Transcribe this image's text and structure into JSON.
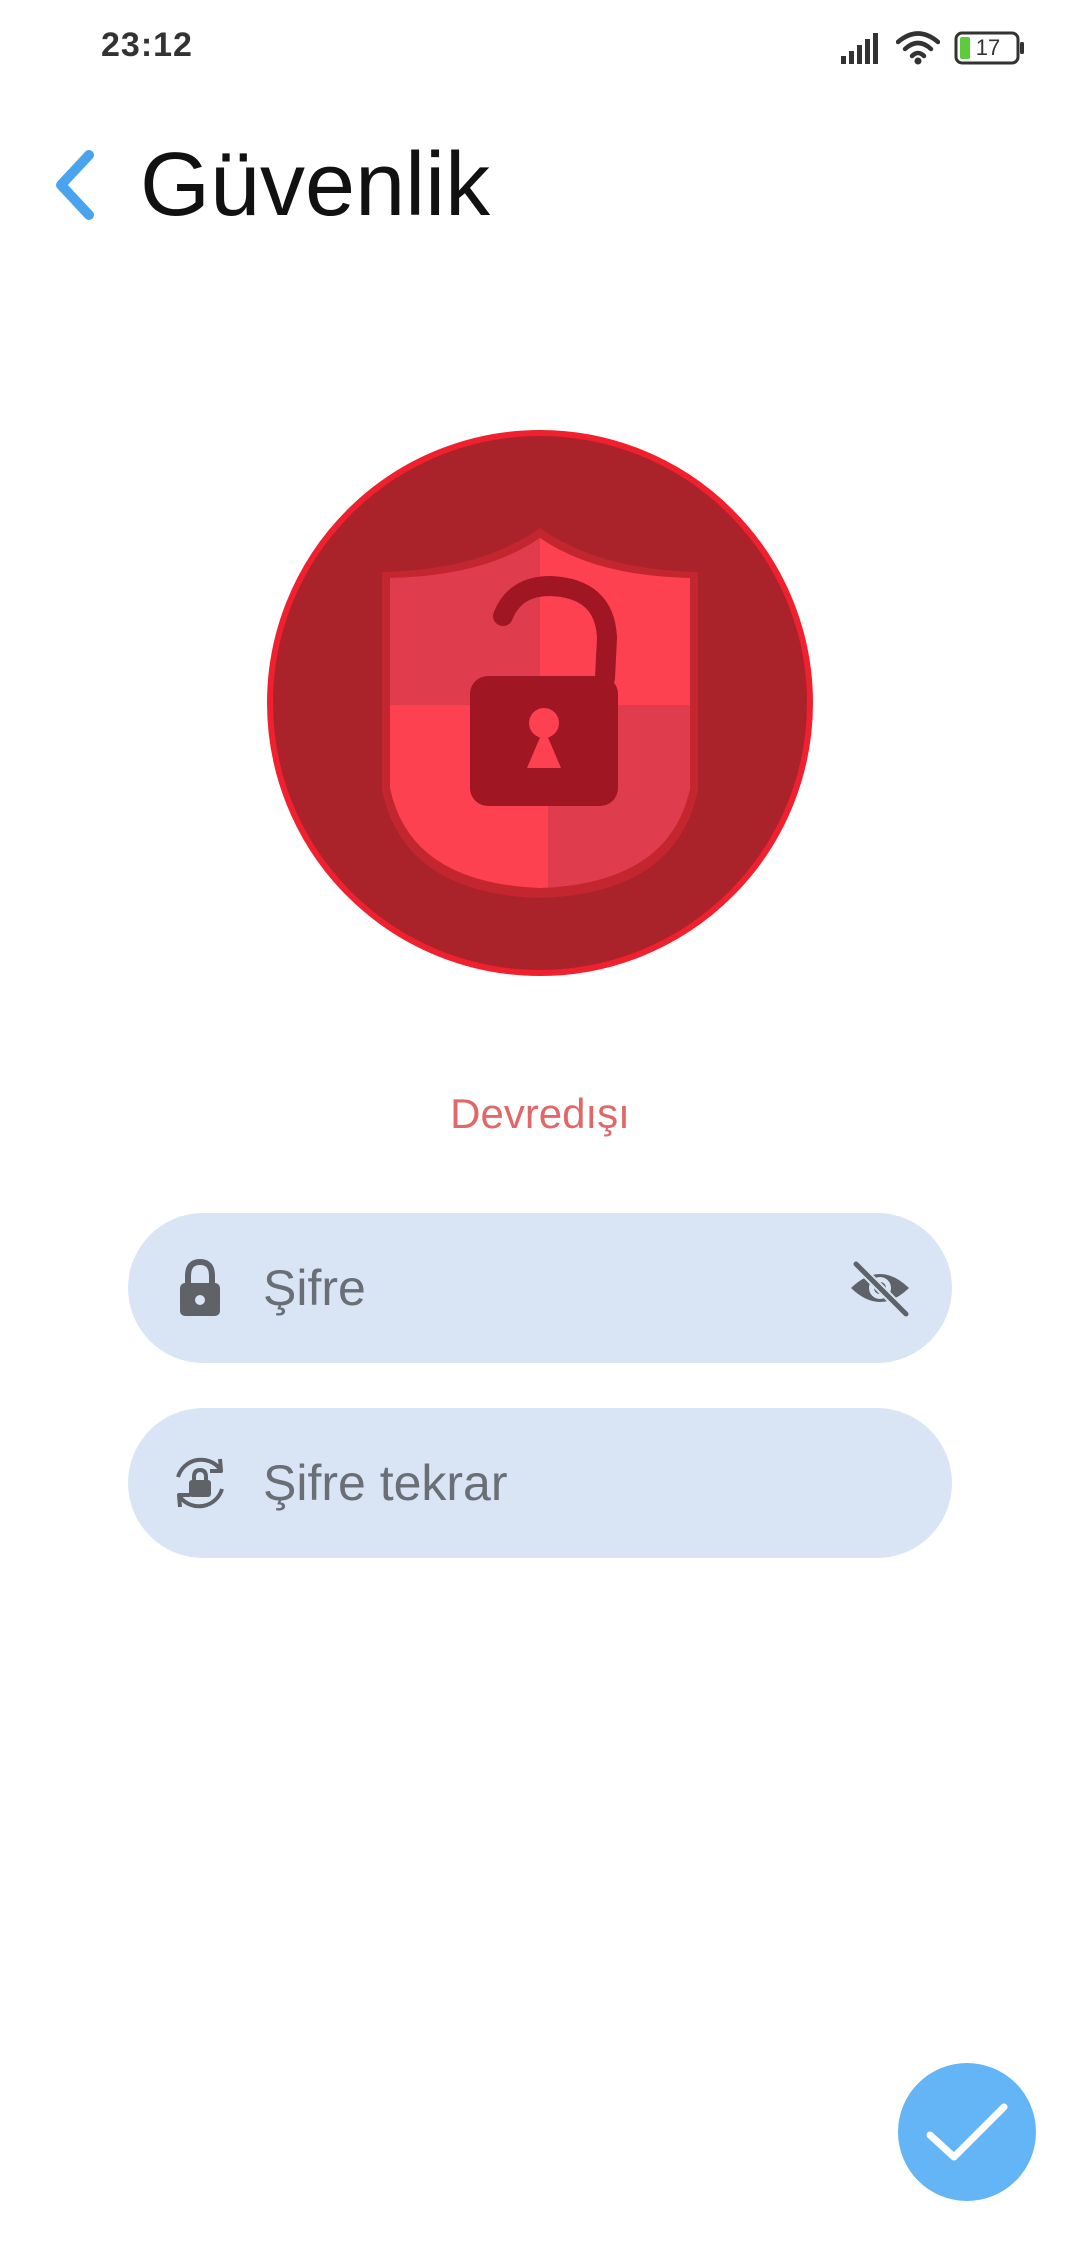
{
  "status_bar": {
    "time": "23:12",
    "battery_level": "17",
    "icons": [
      "signal-icon",
      "wifi-icon",
      "battery-icon"
    ]
  },
  "header": {
    "back_icon": "chevron-left-icon",
    "title": "Güvenlik"
  },
  "security_badge": {
    "icon": "shield-unlocked-padlock-icon",
    "state": "unlocked"
  },
  "status": {
    "label": "Devredışı"
  },
  "password_field": {
    "placeholder": "Şifre",
    "value": "",
    "lead_icon": "lock-icon",
    "toggle_icon": "eye-off-icon"
  },
  "confirm_field": {
    "placeholder": "Şifre tekrar",
    "value": "",
    "lead_icon": "lock-reset-icon"
  },
  "fab": {
    "icon": "checkmark-icon"
  },
  "colors": {
    "accent": "#64b5f6",
    "badge_outer": "#aa232b",
    "badge_border": "#f0202e",
    "shield_light": "#fd4150",
    "shield_dark": "#df3d4d",
    "padlock": "#a01622",
    "status_text": "#e06868",
    "input_bg": "#d9e5f5",
    "input_icon": "#5f6368"
  }
}
